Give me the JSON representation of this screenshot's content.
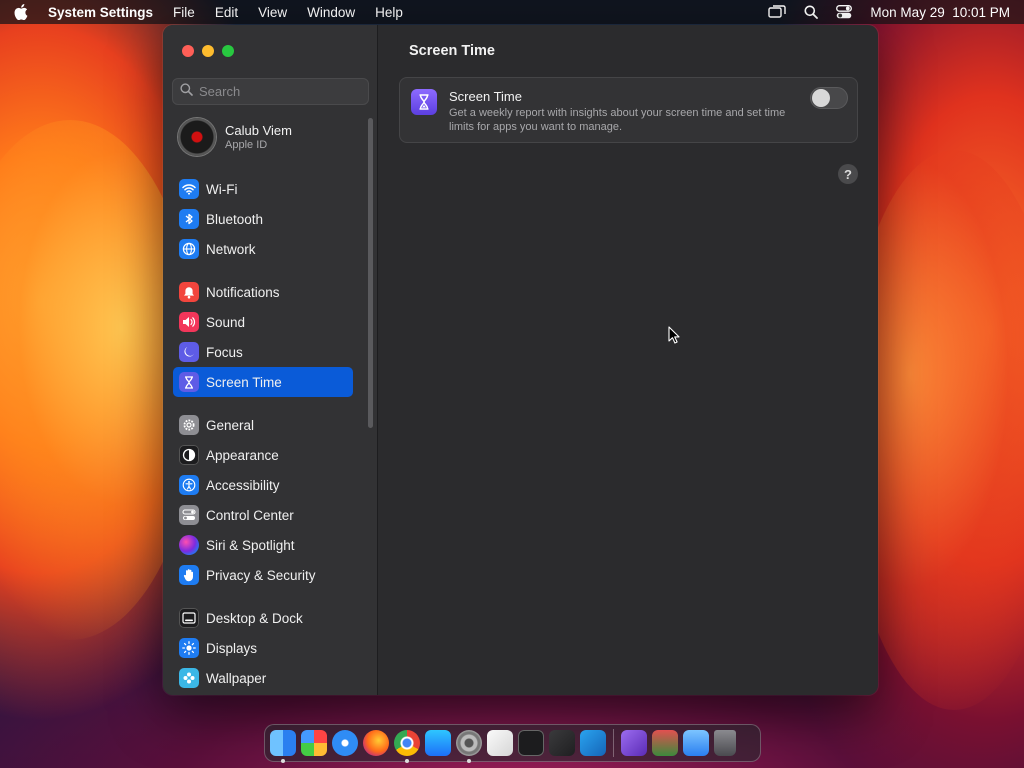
{
  "menubar": {
    "app_name": "System Settings",
    "menus": [
      "File",
      "Edit",
      "View",
      "Window",
      "Help"
    ],
    "clock": "Mon May 29  10:01 PM"
  },
  "sidebar": {
    "search_placeholder": "Search",
    "account": {
      "name": "Calub Viem",
      "subtitle": "Apple ID"
    },
    "items": [
      {
        "label": "Wi-Fi",
        "icon": "wifi-icon",
        "color": "#1e7cf2"
      },
      {
        "label": "Bluetooth",
        "icon": "bluetooth-icon",
        "color": "#1e7cf2"
      },
      {
        "label": "Network",
        "icon": "globe-icon",
        "color": "#1e7cf2"
      },
      {
        "label": "Notifications",
        "icon": "bell-icon",
        "color": "#f2453d"
      },
      {
        "label": "Sound",
        "icon": "speaker-icon",
        "color": "#f2365a"
      },
      {
        "label": "Focus",
        "icon": "moon-icon",
        "color": "#5e5ce6"
      },
      {
        "label": "Screen Time",
        "icon": "hourglass-icon",
        "color": "#5e5ce6",
        "active": true
      },
      {
        "label": "General",
        "icon": "gear-icon",
        "color": "#8e8e93"
      },
      {
        "label": "Appearance",
        "icon": "appearance-icon",
        "color": "#1c1c1e"
      },
      {
        "label": "Accessibility",
        "icon": "accessibility-icon",
        "color": "#1e7cf2"
      },
      {
        "label": "Control Center",
        "icon": "toggles-icon",
        "color": "#8e8e93"
      },
      {
        "label": "Siri & Spotlight",
        "icon": "siri-icon",
        "color": "#a0249b"
      },
      {
        "label": "Privacy & Security",
        "icon": "hand-icon",
        "color": "#1e7cf2"
      },
      {
        "label": "Desktop & Dock",
        "icon": "dock-icon",
        "color": "#1c1c1e"
      },
      {
        "label": "Displays",
        "icon": "sun-icon",
        "color": "#1e7cf2"
      },
      {
        "label": "Wallpaper",
        "icon": "wallpaper-icon",
        "color": "#3bb7e6"
      }
    ]
  },
  "content": {
    "title": "Screen Time",
    "card": {
      "title": "Screen Time",
      "description": "Get a weekly report with insights about your screen time and set time limits for apps you want to manage.",
      "toggle_on": false
    },
    "help_label": "?"
  },
  "dock": {
    "apps": [
      {
        "name": "finder-icon",
        "color": "#3a8ef6",
        "running": true
      },
      {
        "name": "launchpad-icon",
        "color": "#e9e9ef",
        "running": false
      },
      {
        "name": "safari-icon",
        "color": "#2f8cf5",
        "running": false
      },
      {
        "name": "firefox-icon",
        "color": "#ff6a1a",
        "running": false
      },
      {
        "name": "chrome-icon",
        "color": "#e8e8e8",
        "running": true
      },
      {
        "name": "app-store-icon",
        "color": "#1d8cf8",
        "running": false
      },
      {
        "name": "system-settings-icon",
        "color": "#8e8e93",
        "running": true
      },
      {
        "name": "textedit-icon",
        "color": "#f4f4f4",
        "running": false
      },
      {
        "name": "terminal-icon",
        "color": "#1c1c1e",
        "running": false
      },
      {
        "name": "instruments-icon",
        "color": "#3a3a3c",
        "running": false
      },
      {
        "name": "vscode-icon",
        "color": "#1f8ad2",
        "running": false
      },
      {
        "name": "visual-studio-icon",
        "color": "#6e3fc9",
        "running": false
      },
      {
        "name": "testflight-icon",
        "color": "#c83b3b",
        "running": false
      },
      {
        "name": "simulator-icon",
        "color": "#4aa6f7",
        "running": false
      },
      {
        "name": "trash-icon",
        "color": "#6e6e73",
        "running": false
      }
    ]
  }
}
